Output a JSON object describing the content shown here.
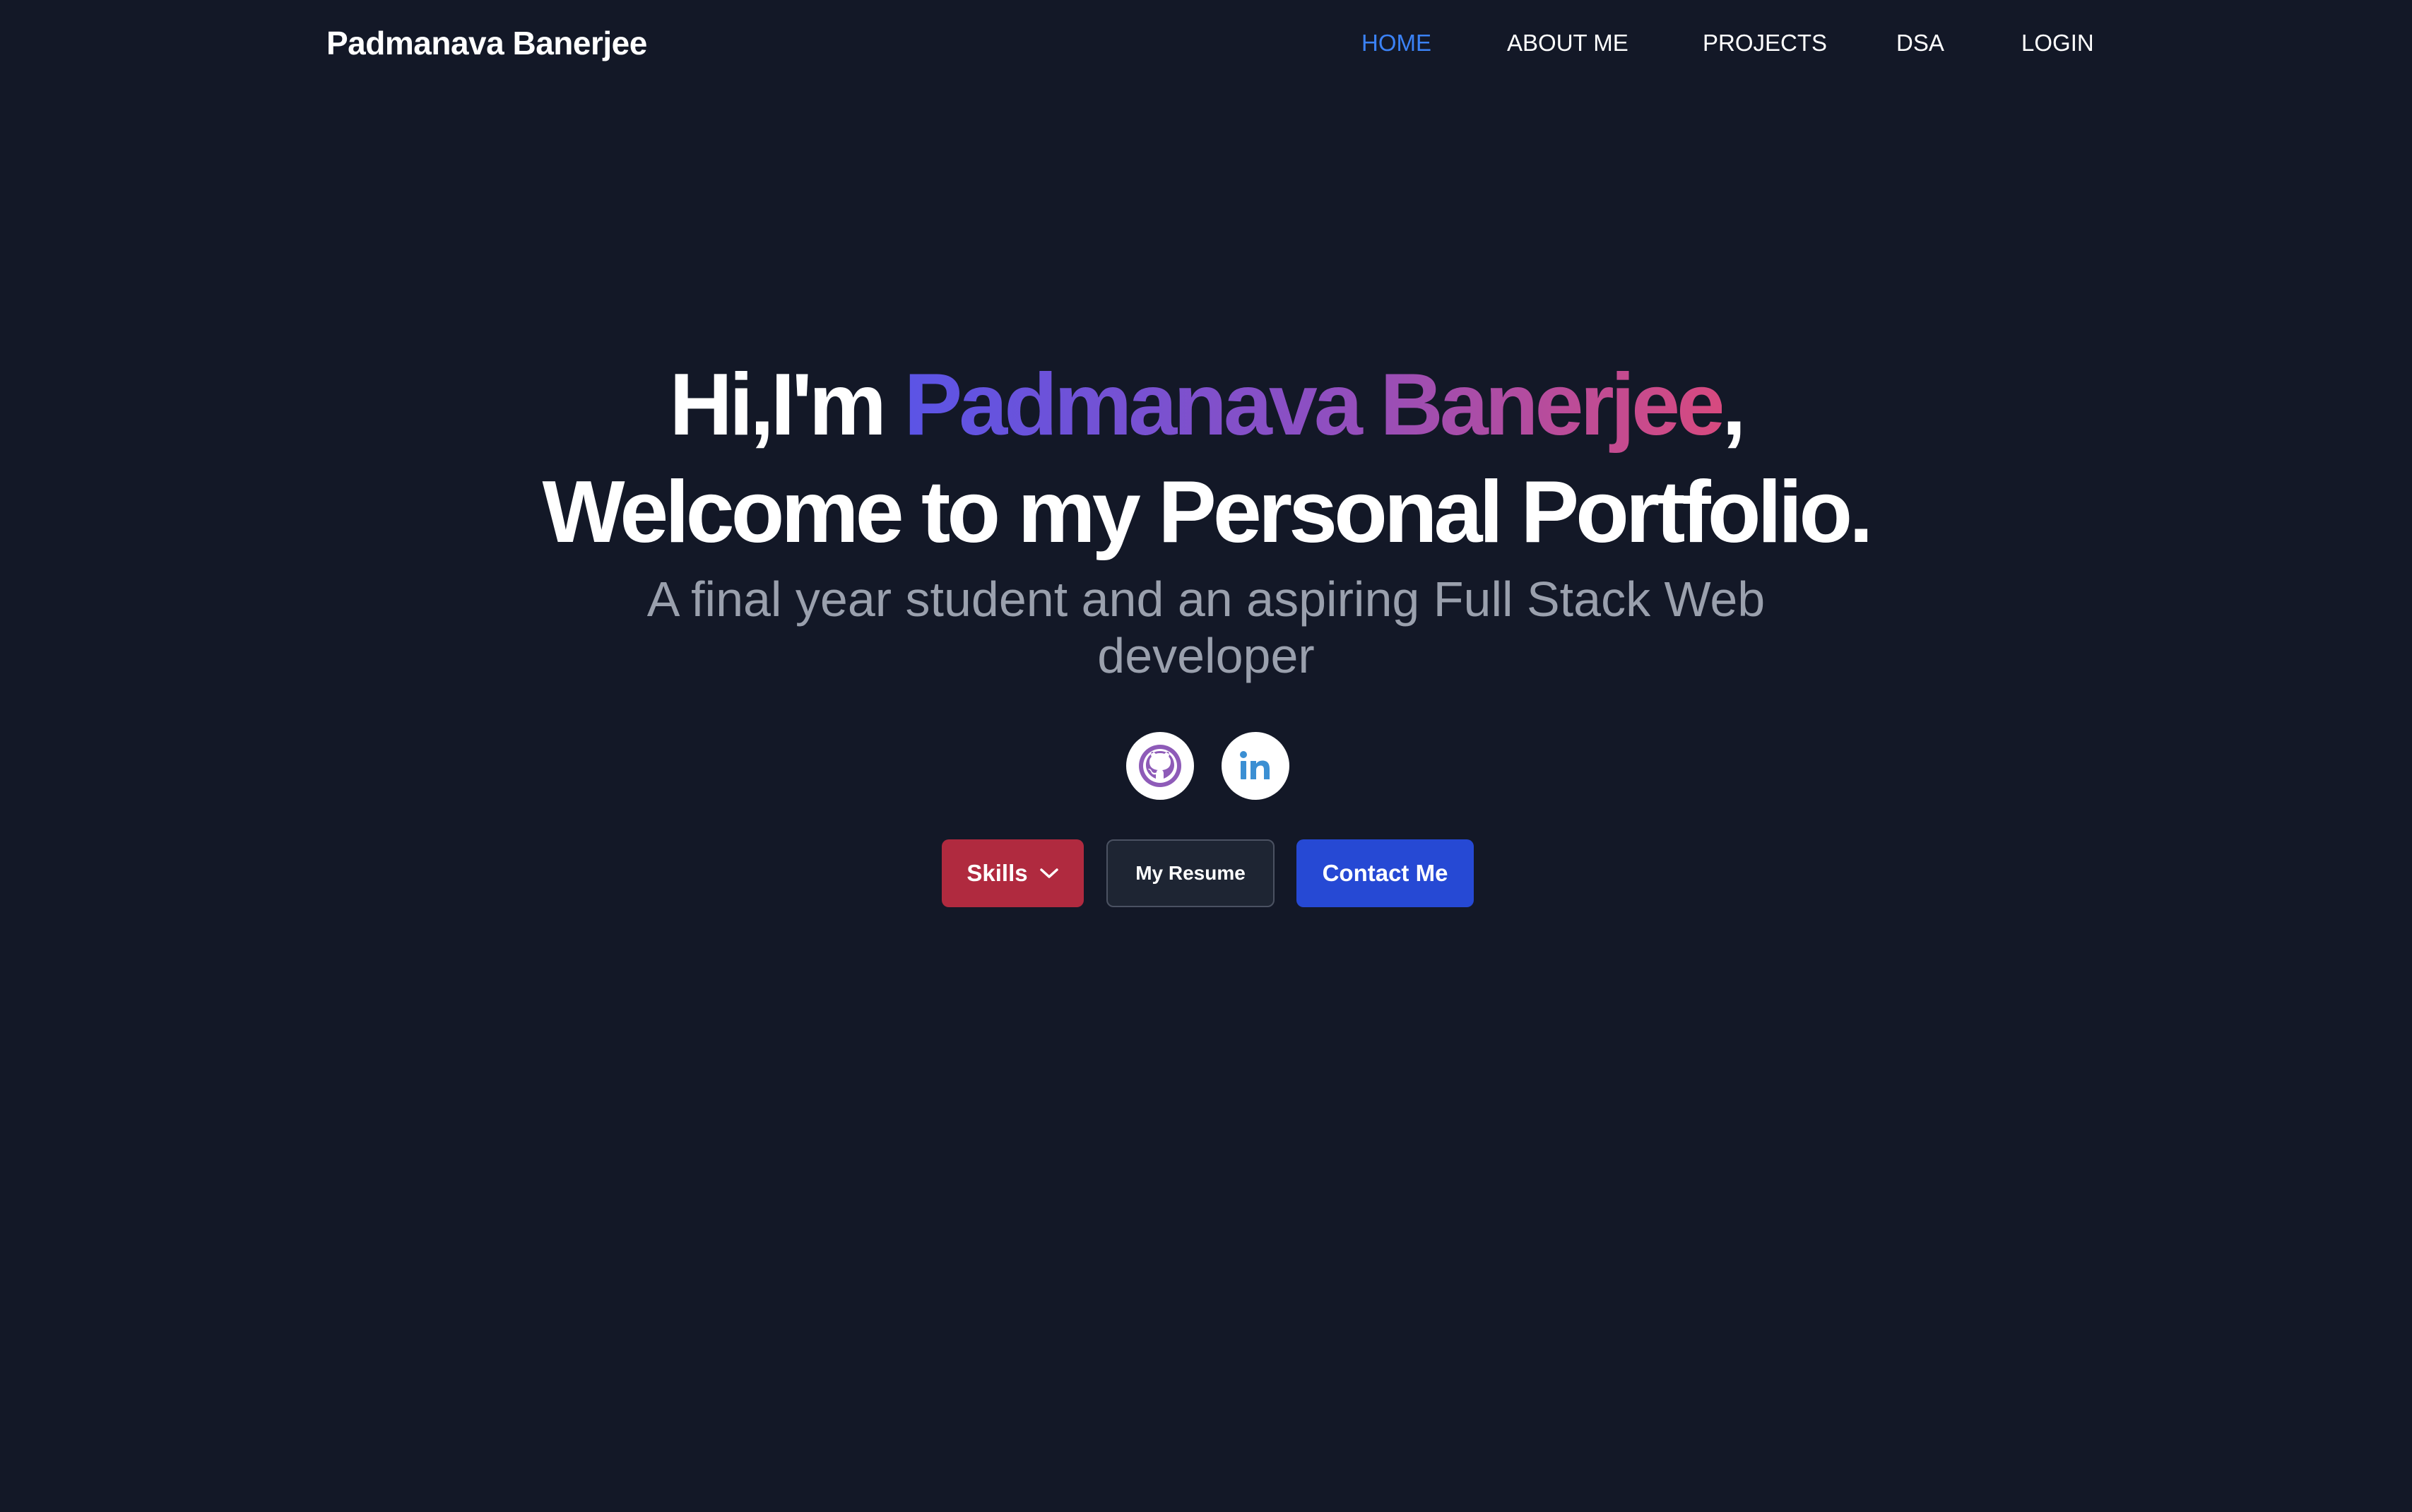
{
  "navbar": {
    "brand": "Padmanava Banerjee",
    "links": [
      {
        "label": "HOME",
        "active": true
      },
      {
        "label": "ABOUT ME",
        "active": false
      },
      {
        "label": "PROJECTS",
        "active": false
      },
      {
        "label": "DSA",
        "active": false
      },
      {
        "label": "LOGIN",
        "active": false
      }
    ]
  },
  "hero": {
    "greeting_prefix": "Hi,I'm ",
    "name": "Padmanava Banerjee",
    "greeting_suffix": ",",
    "welcome": "Welcome to my Personal Portfolio.",
    "tagline": "A final year student and an aspiring Full Stack Web developer"
  },
  "social": [
    {
      "icon": "github-icon",
      "color": "#8e5bb8"
    },
    {
      "icon": "linkedin-icon",
      "color": "#3b8fd3"
    }
  ],
  "buttons": {
    "skills": "Skills",
    "resume": "My Resume",
    "contact": "Contact Me"
  },
  "colors": {
    "background": "#131827",
    "nav_active": "#3b82f6",
    "name_gradient": [
      "#5b54e6",
      "#8d4fc2",
      "#d74a7f"
    ],
    "skills_button": "#b02a3f",
    "resume_button": "#1e2533",
    "contact_button": "#2649d4",
    "tagline": "#9aa0ad"
  }
}
